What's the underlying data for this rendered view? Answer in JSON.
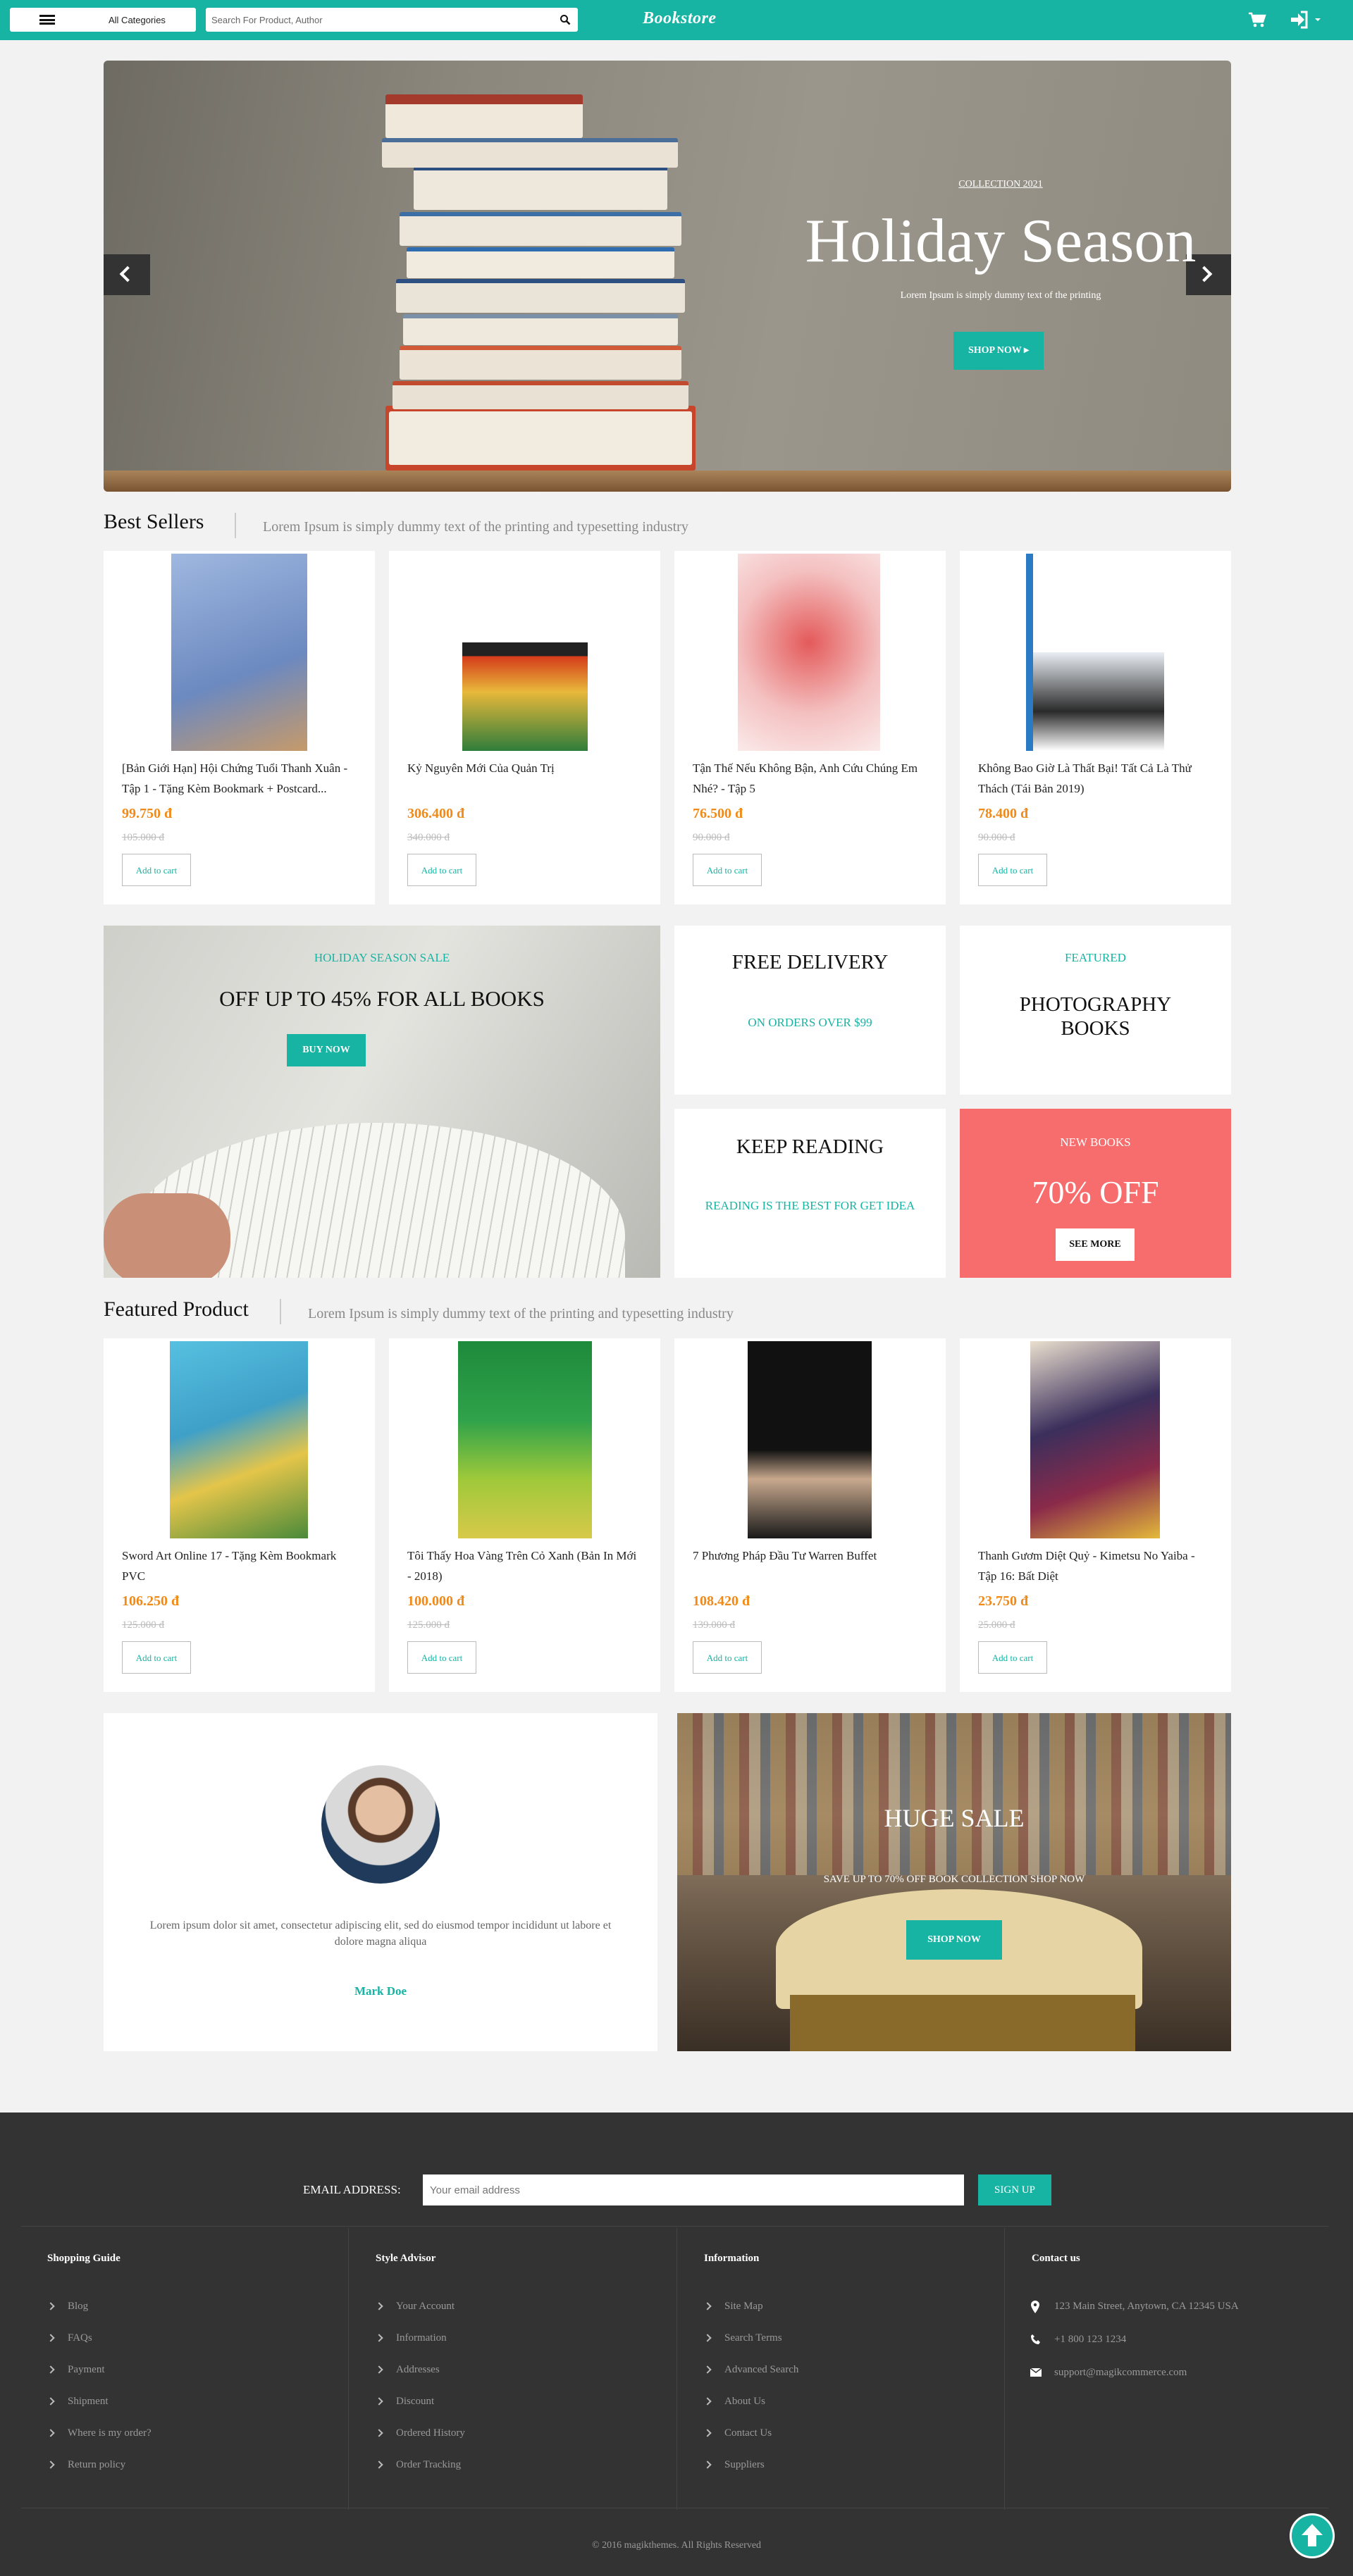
{
  "header": {
    "categories_label": "All Categories",
    "search_placeholder": "Search For Product, Author",
    "logo": "Bookstore"
  },
  "hero": {
    "eyebrow": "COLLECTION 2021",
    "title": "Holiday Season",
    "subtitle": "Lorem Ipsum is simply dummy text of the printing",
    "button": "SHOP NOW ▸"
  },
  "best_sellers": {
    "title": "Best Sellers",
    "subtitle": "Lorem Ipsum is simply dummy text of the printing and typesetting industry",
    "products": [
      {
        "name": "[Bản Giới Hạn] Hội Chứng Tuổi Thanh Xuân - Tập 1 - Tặng Kèm Bookmark + Postcard...",
        "price": "99.750 đ",
        "old_price": "105.000 đ",
        "button": "Add to cart",
        "cover": "#7f9ecf"
      },
      {
        "name": "Kỷ Nguyên Mới Của Quản Trị",
        "price": "306.400 đ",
        "old_price": "340.000 đ",
        "button": "Add to cart",
        "cover": "#d84a1a"
      },
      {
        "name": "Tận Thế Nếu Không Bận, Anh Cứu Chúng Em Nhé? - Tập 5",
        "price": "76.500 đ",
        "old_price": "90.000 đ",
        "button": "Add to cart",
        "cover": "#e25a5a"
      },
      {
        "name": "Không Bao Giờ Là Thất Bại! Tất Cả Là Thử Thách (Tái Bản 2019)",
        "price": "78.400 đ",
        "old_price": "90.000 đ",
        "button": "Add to cart",
        "cover": "#2a7bc4"
      }
    ]
  },
  "promo": {
    "holiday_eyebrow": "HOLIDAY SEASON SALE",
    "holiday_title": "OFF UP TO 45% FOR ALL BOOKS",
    "holiday_button": "BUY NOW",
    "delivery_title": "FREE DELIVERY",
    "delivery_sub": "ON ORDERS OVER $99",
    "featured_eyebrow": "FEATURED",
    "featured_title_line1": "PHOTOGRAPHY",
    "featured_title_line2": "BOOKS",
    "keep_title": "KEEP READING",
    "keep_sub": "READING IS THE BEST FOR GET IDEA",
    "new_eyebrow": "NEW BOOKS",
    "new_title": "70% OFF",
    "new_button": "SEE MORE"
  },
  "featured": {
    "title": "Featured Product",
    "subtitle": "Lorem Ipsum is simply dummy text of the printing and typesetting industry",
    "products": [
      {
        "name": "Sword Art Online 17 - Tặng Kèm Bookmark PVC",
        "price": "106.250 đ",
        "old_price": "125.000 đ",
        "button": "Add to cart",
        "cover": "#3fa0c8"
      },
      {
        "name": "Tôi Thấy Hoa Vàng Trên Cỏ Xanh (Bản In Mới - 2018)",
        "price": "100.000 đ",
        "old_price": "125.000 đ",
        "button": "Add to cart",
        "cover": "#1e8a3c"
      },
      {
        "name": "7 Phương Pháp Đầu Tư Warren Buffet",
        "price": "108.420 đ",
        "old_price": "139.000 đ",
        "button": "Add to cart",
        "cover": "#111111"
      },
      {
        "name": "Thanh Gươm Diệt Quỷ - Kimetsu No Yaiba - Tập 16: Bất Diệt",
        "price": "23.750 đ",
        "old_price": "25.000 đ",
        "button": "Add to cart",
        "cover": "#3b2f5c"
      }
    ]
  },
  "testimonial": {
    "quote": "Lorem ipsum dolor sit amet, consectetur adipiscing elit, sed do eiusmod tempor incididunt ut labore et dolore magna aliqua",
    "author": "Mark Doe"
  },
  "huge_sale": {
    "title": "HUGE SALE",
    "subtitle": "SAVE UP TO 70% OFF BOOK COLLECTION SHOP NOW",
    "button": "SHOP NOW"
  },
  "footer": {
    "email_label": "EMAIL ADDRESS:",
    "email_placeholder": "Your email address",
    "signup": "SIGN UP",
    "columns": [
      {
        "title": "Shopping Guide",
        "links": [
          "Blog",
          "FAQs",
          "Payment",
          "Shipment",
          "Where is my order?",
          "Return policy"
        ]
      },
      {
        "title": "Style Advisor",
        "links": [
          "Your Account",
          "Information",
          "Addresses",
          "Discount",
          "Ordered History",
          "Order Tracking"
        ]
      },
      {
        "title": "Information",
        "links": [
          "Site Map",
          "Search Terms",
          "Advanced Search",
          "About Us",
          "Contact Us",
          "Suppliers"
        ]
      }
    ],
    "contact": {
      "title": "Contact us",
      "address": "123 Main Street, Anytown, CA 12345 USA",
      "phone": "+1 800 123 1234",
      "email": "support@magikcommerce.com"
    },
    "copyright": "© 2016 magikthemes. All Rights Reserved"
  },
  "colors": {
    "accent": "#17b3a3",
    "price": "#f08a19",
    "coral": "#f76c6c",
    "footer": "#333333"
  }
}
